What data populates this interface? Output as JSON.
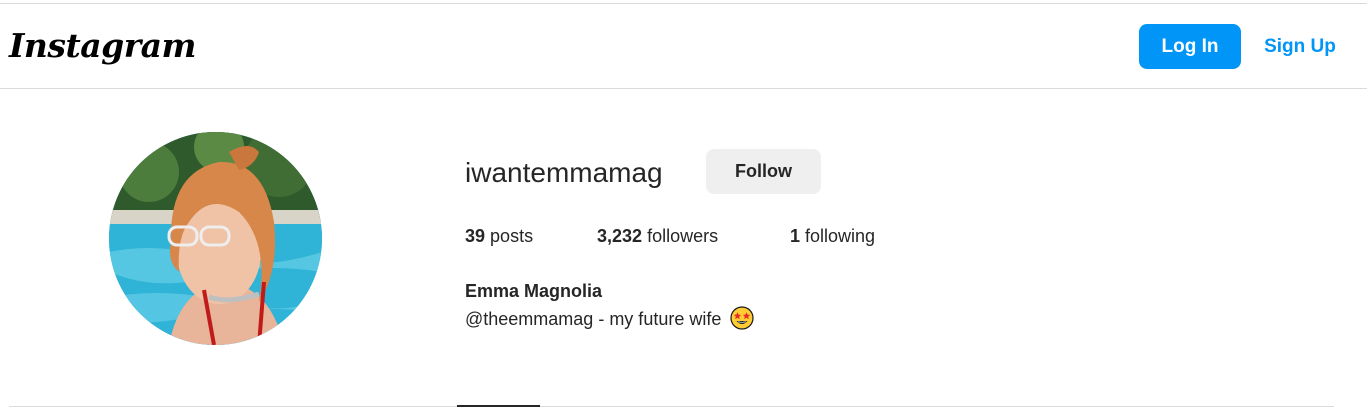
{
  "header": {
    "logo": "Instagram",
    "login_label": "Log In",
    "signup_label": "Sign Up"
  },
  "profile": {
    "username": "iwantemmamag",
    "follow_label": "Follow",
    "stats": {
      "posts_count": "39",
      "posts_label": "posts",
      "followers_count": "3,232",
      "followers_label": "followers",
      "following_count": "1",
      "following_label": "following"
    },
    "full_name": "Emma Magnolia",
    "bio": "@theemmamag - my future wife",
    "bio_emoji": "star-struck-emoji-icon"
  },
  "colors": {
    "accent": "#0095f6",
    "follow_bg": "#efefef",
    "divider": "#dbdbdb",
    "text": "#262626"
  }
}
